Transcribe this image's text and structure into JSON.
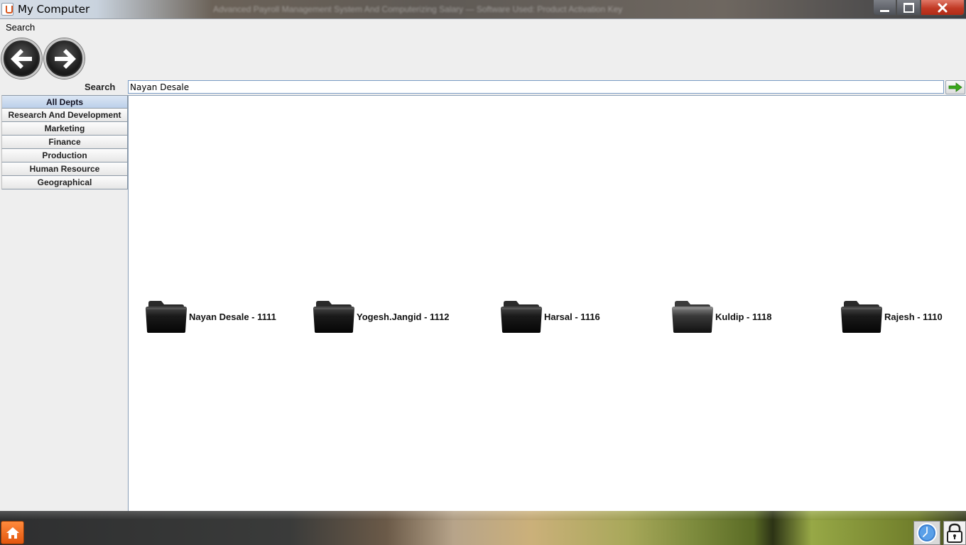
{
  "window": {
    "title": "My Computer",
    "blurred_title": "Advanced Payroll Management System And Computerizing Salary — Software Used: Product Activation Key"
  },
  "menu": {
    "search_label": "Search"
  },
  "nav": {
    "back_icon": "arrow-left-icon",
    "forward_icon": "arrow-right-icon"
  },
  "search": {
    "label": "Search",
    "value": "Nayan Desale",
    "go_icon": "arrow-right-icon"
  },
  "sidebar": {
    "items": [
      {
        "label": "All Depts",
        "active": true
      },
      {
        "label": "Research And Development",
        "active": false
      },
      {
        "label": "Marketing",
        "active": false
      },
      {
        "label": "Finance",
        "active": false
      },
      {
        "label": "Production",
        "active": false
      },
      {
        "label": "Human Resource",
        "active": false
      },
      {
        "label": "Geographical",
        "active": false
      }
    ]
  },
  "results": {
    "folders": [
      {
        "label": "Nayan Desale - 1111"
      },
      {
        "label": "Yogesh.Jangid - 1112"
      },
      {
        "label": "Harsal - 1116"
      },
      {
        "label": "Kuldip - 1118"
      },
      {
        "label": "Rajesh - 1110"
      }
    ]
  },
  "taskbar": {
    "home_icon": "home-icon",
    "clock_icon": "clock-icon",
    "lock_icon": "lock-icon"
  },
  "colors": {
    "accent": "#e2560e",
    "active_tab": "#bcd0ea",
    "close_button": "#c13a25"
  }
}
